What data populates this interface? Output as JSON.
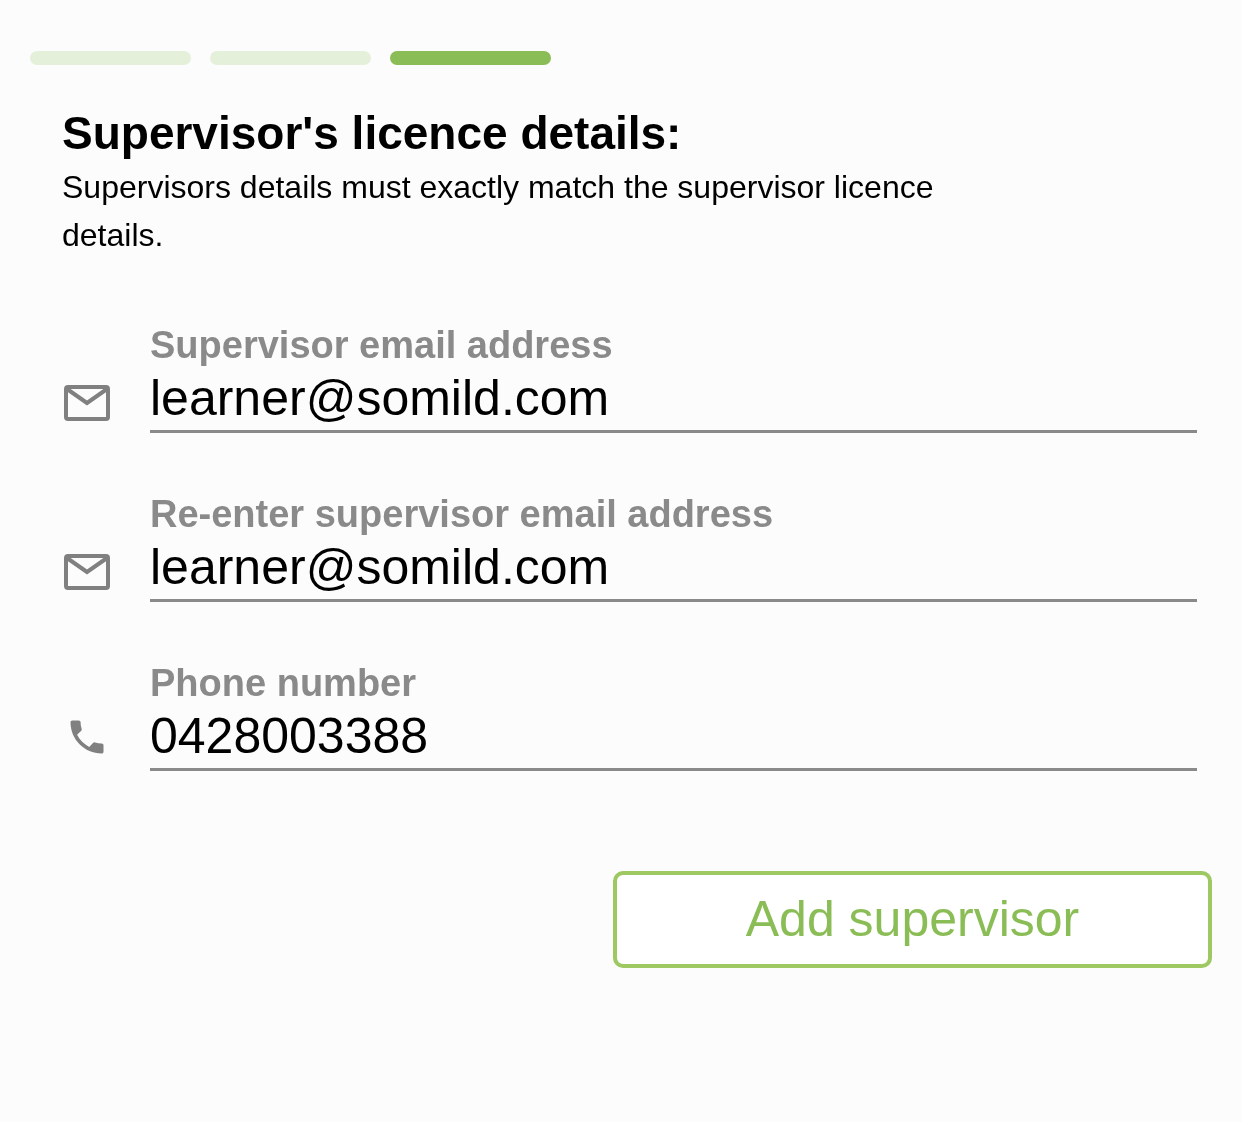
{
  "progress_steps": [
    {
      "selected": false
    },
    {
      "selected": false
    },
    {
      "selected": true
    }
  ],
  "title": "Supervisor's licence details:",
  "description": "Supervisors details must exactly match the supervisor licence details.",
  "fields": [
    {
      "kind": "email",
      "label": "Supervisor email address",
      "value": "learner@somild.com"
    },
    {
      "kind": "email",
      "label": "Re-enter supervisor email address",
      "value": "learner@somild.com"
    },
    {
      "kind": "phone",
      "label": "Phone number",
      "value": "0428003388"
    }
  ],
  "button": "Add supervisor"
}
